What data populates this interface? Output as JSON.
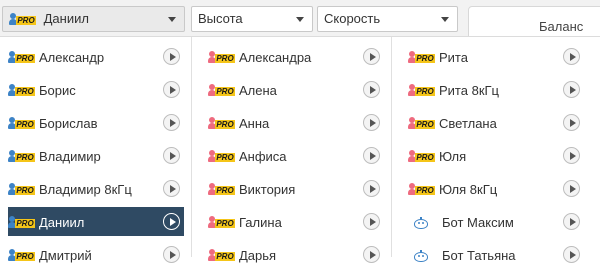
{
  "header": {
    "voice_select": "Даниил",
    "height_select": "Высота",
    "speed_select": "Скорость",
    "balance_label": "Баланс"
  },
  "pro_badge": "PRO",
  "columns": [
    [
      {
        "label": "Александр",
        "gender": "male"
      },
      {
        "label": "Борис",
        "gender": "male"
      },
      {
        "label": "Борислав",
        "gender": "male"
      },
      {
        "label": "Владимир",
        "gender": "male"
      },
      {
        "label": "Владимир 8кГц",
        "gender": "male"
      },
      {
        "label": "Даниил",
        "gender": "male",
        "selected": true
      },
      {
        "label": "Дмитрий",
        "gender": "male"
      }
    ],
    [
      {
        "label": "Александра",
        "gender": "female"
      },
      {
        "label": "Алена",
        "gender": "female"
      },
      {
        "label": "Анна",
        "gender": "female"
      },
      {
        "label": "Анфиса",
        "gender": "female"
      },
      {
        "label": "Виктория",
        "gender": "female"
      },
      {
        "label": "Галина",
        "gender": "female"
      },
      {
        "label": "Дарья",
        "gender": "female"
      }
    ],
    [
      {
        "label": "Рита",
        "gender": "female"
      },
      {
        "label": "Рита 8кГц",
        "gender": "female"
      },
      {
        "label": "Светлана",
        "gender": "female"
      },
      {
        "label": "Юля",
        "gender": "female"
      },
      {
        "label": "Юля 8кГц",
        "gender": "female"
      },
      {
        "label": "Бот Максим",
        "gender": "bot"
      },
      {
        "label": "Бот Татьяна",
        "gender": "bot"
      }
    ]
  ],
  "colors": {
    "selected_bg": "#2f4a63",
    "male_icon": "#3d83c6",
    "female_icon": "#ee6b7f",
    "pro_badge": "#f5c518"
  }
}
